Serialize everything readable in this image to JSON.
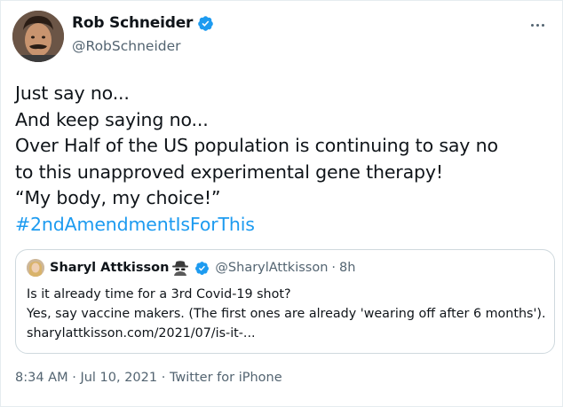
{
  "author": {
    "display_name": "Rob Schneider",
    "handle": "@RobSchneider",
    "verified": true
  },
  "tweet": {
    "lines": [
      "Just say no...",
      "And keep saying no...",
      "Over Half of the US population is continuing to say no",
      "to this unapproved experimental gene therapy!",
      "“My body, my choice!”"
    ],
    "hashtag": "#2ndAmendmentIsForThis"
  },
  "quoted_tweet": {
    "display_name": "Sharyl Attkisson",
    "name_emoji": "spy-icon",
    "verified": true,
    "handle": "@SharylAttkisson",
    "separator": "·",
    "time": "8h",
    "lines": [
      "Is it already time for a 3rd Covid-19 shot?",
      "Yes, say vaccine makers. (The first ones are already 'wearing off after 6 months').",
      "sharylattkisson.com/2021/07/is-it-..."
    ]
  },
  "footer": {
    "time": "8:34 AM",
    "separator1": " · ",
    "date": "Jul 10, 2021",
    "separator2": " · ",
    "source": "Twitter for iPhone"
  },
  "colors": {
    "accent": "#1d9bf0",
    "text": "#0f1419",
    "secondary": "#536471",
    "border": "#cfd9de"
  }
}
